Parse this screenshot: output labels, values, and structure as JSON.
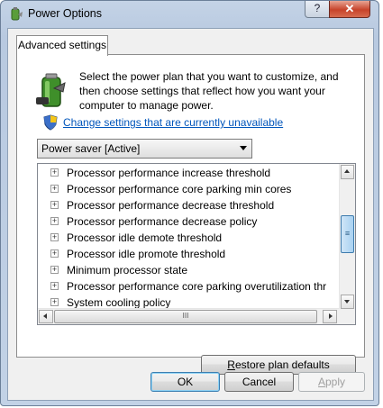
{
  "window": {
    "title": "Power Options",
    "help_label": "?",
    "close_label": "✕"
  },
  "tab": {
    "label": "Advanced settings"
  },
  "description": "Select the power plan that you want to customize, and then choose settings that reflect how you want your computer to manage power.",
  "change_link": "Change settings that are currently unavailable",
  "plan_select": {
    "value": "Power saver [Active]"
  },
  "tree": {
    "items": [
      "Processor performance increase threshold",
      "Processor performance core parking min cores",
      "Processor performance decrease threshold",
      "Processor performance decrease policy",
      "Processor idle demote threshold",
      "Processor idle promote threshold",
      "Minimum processor state",
      "Processor performance core parking overutilization thr",
      "System cooling policy"
    ],
    "expander_symbol": "+"
  },
  "scroll": {
    "hthumb_grip": "III",
    "vthumb_grip": "≡"
  },
  "buttons": {
    "restore_accel": "R",
    "restore_rest": "estore plan defaults",
    "ok": "OK",
    "cancel": "Cancel",
    "apply_accel": "A",
    "apply_rest": "pply"
  },
  "colors": {
    "link": "#0055bb",
    "accent": "#3c7fb1"
  }
}
